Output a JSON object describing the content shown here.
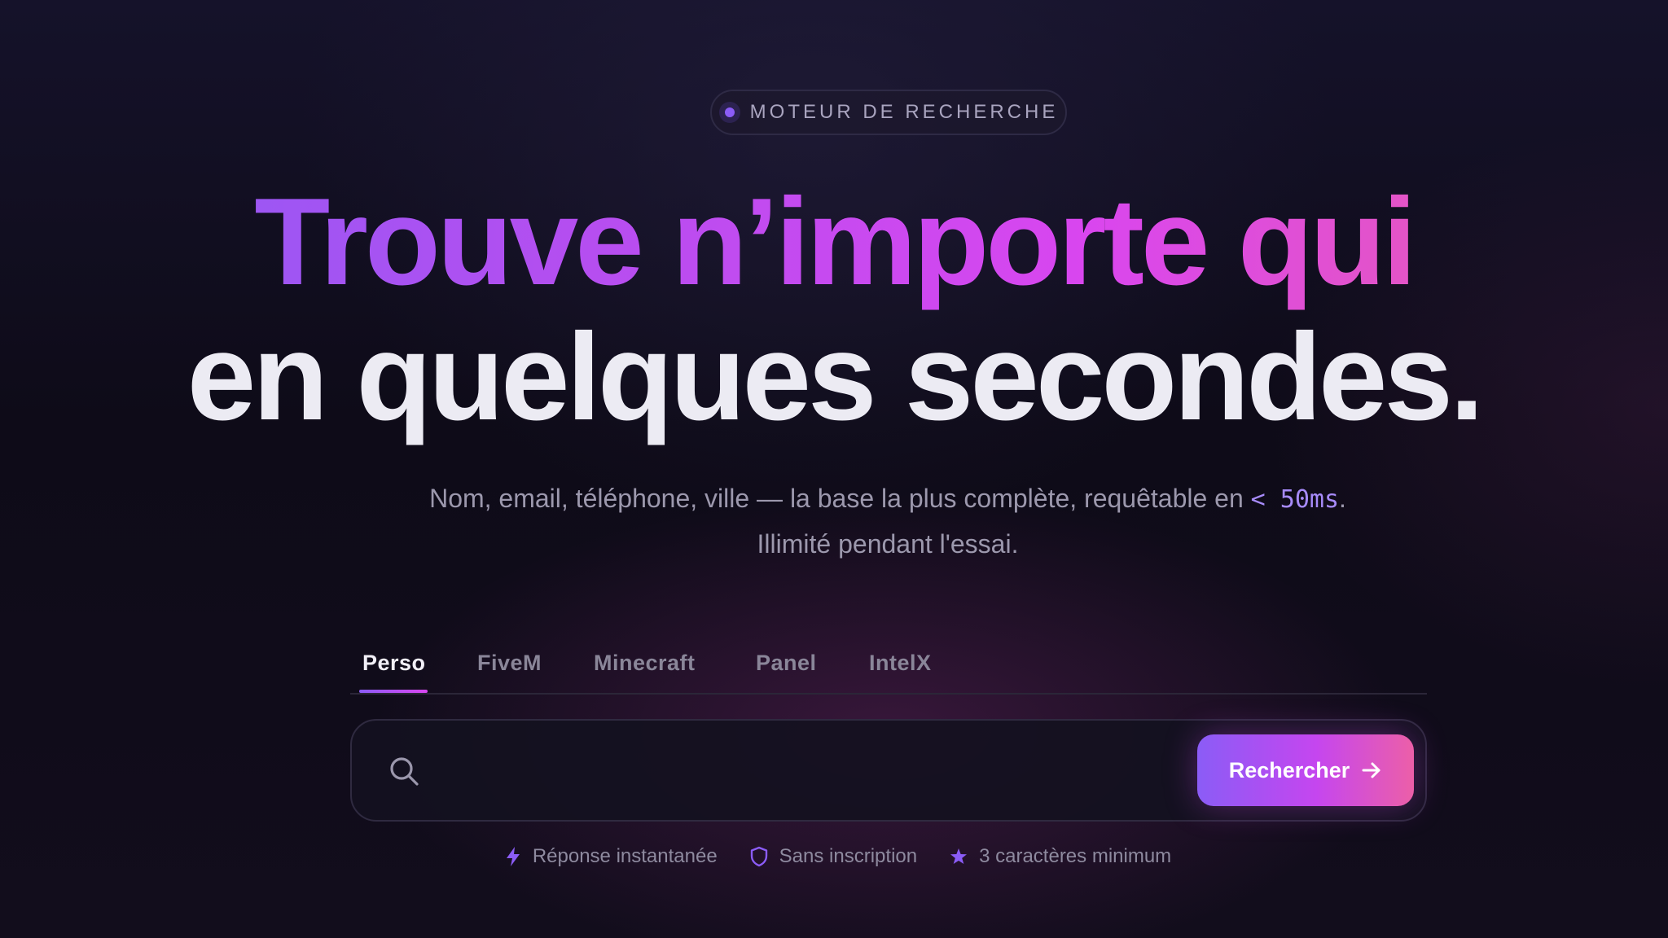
{
  "badge": {
    "label": "MOTEUR DE RECHERCHE"
  },
  "hero": {
    "line1": "Trouve n’importe qui",
    "line2": "en quelques secondes."
  },
  "subtitle": {
    "text_before": "Nom, email, téléphone, ville — la base la plus complète, requêtable en ",
    "highlight": "< 50ms",
    "text_after": ". Illimité pendant l'essai."
  },
  "tabs": [
    {
      "label": "Perso",
      "active": true
    },
    {
      "label": "FiveM",
      "active": false
    },
    {
      "label": "Minecraft",
      "active": false
    },
    {
      "label": "Panel",
      "active": false
    },
    {
      "label": "IntelX",
      "active": false
    }
  ],
  "search": {
    "value": "",
    "placeholder": "",
    "button_label": "Rechercher",
    "icon": "search-icon",
    "button_icon": "arrow-right-icon"
  },
  "features": [
    {
      "icon": "lightning-icon",
      "label": "Réponse instantanée"
    },
    {
      "icon": "shield-icon",
      "label": "Sans inscription"
    },
    {
      "icon": "star-icon",
      "label": "3 caractères minimum"
    }
  ],
  "colors": {
    "accent_purple": "#8b5cf6",
    "accent_magenta": "#d946ef",
    "accent_pink": "#ec5fa8",
    "background": "#0f0c1a",
    "heading_white": "#ecebf3"
  }
}
